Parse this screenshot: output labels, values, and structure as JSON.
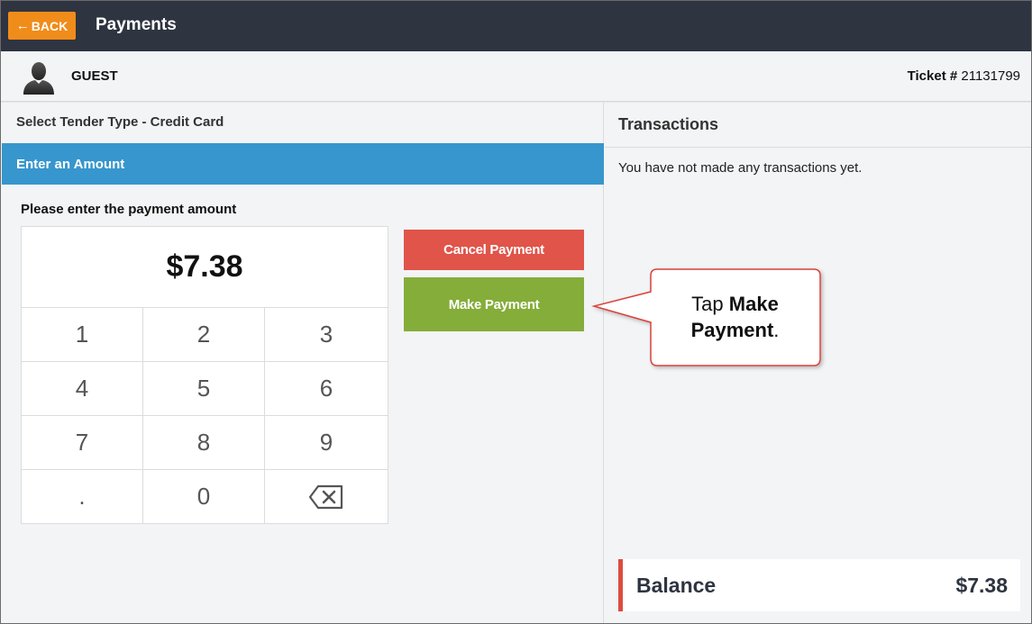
{
  "header": {
    "back_label": "BACK",
    "title": "Payments"
  },
  "guest": {
    "name": "GUEST",
    "ticket_label": "Ticket #",
    "ticket_number": "21131799"
  },
  "payment": {
    "tender_type": "Select Tender Type - Credit Card",
    "section_title": "Enter an Amount",
    "prompt": "Please enter the payment amount",
    "amount": "$7.38",
    "keys": [
      "1",
      "2",
      "3",
      "4",
      "5",
      "6",
      "7",
      "8",
      "9",
      ".",
      "0"
    ],
    "backspace_icon": "backspace-icon",
    "cancel_label": "Cancel Payment",
    "make_label": "Make Payment"
  },
  "transactions": {
    "title": "Transactions",
    "empty_message": "You have not made any transactions yet.",
    "balance_label": "Balance",
    "balance_value": "$7.38"
  },
  "callout": {
    "text_before": "Tap ",
    "text_bold": "Make Payment",
    "text_after": "."
  },
  "colors": {
    "topbar": "#2e3440",
    "back": "#f08c1a",
    "section_bar": "#3796cd",
    "cancel": "#e0544a",
    "make": "#85ad3a",
    "balance_accent": "#de4b3f",
    "callout_border": "#d9433a"
  }
}
